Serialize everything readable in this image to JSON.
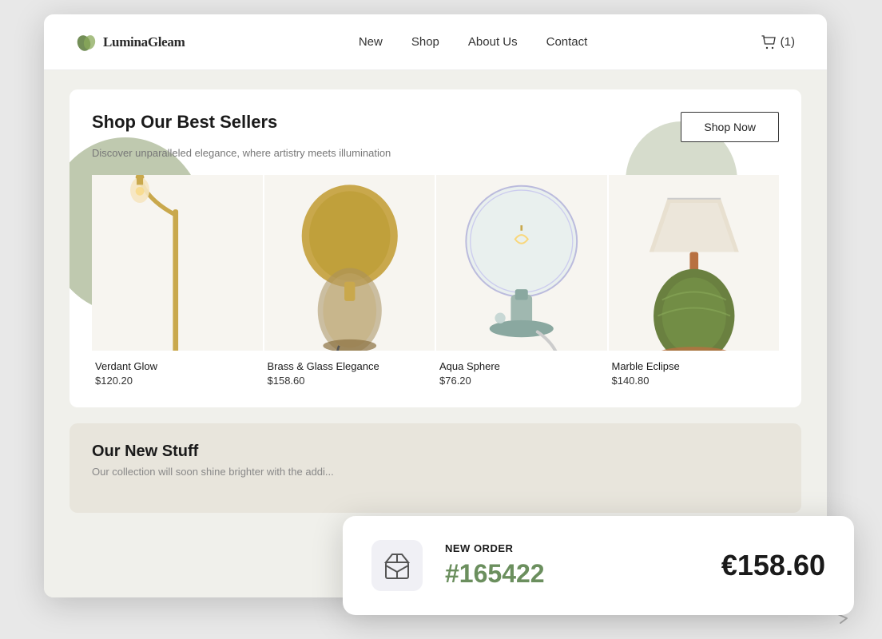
{
  "browser": {
    "background": "#e8e8e8"
  },
  "navbar": {
    "logo_text": "LuminaGleam",
    "nav_items": [
      {
        "label": "New",
        "href": "#"
      },
      {
        "label": "Shop",
        "href": "#"
      },
      {
        "label": "About Us",
        "href": "#"
      },
      {
        "label": "Contact",
        "href": "#"
      }
    ],
    "cart_label": "(1)"
  },
  "best_sellers": {
    "title": "Shop Our Best Sellers",
    "subtitle": "Discover unparalleled elegance, where artistry meets illumination",
    "shop_now_btn": "Shop Now",
    "products": [
      {
        "name": "Verdant Glow",
        "price": "$120.20",
        "lamp_type": "arc"
      },
      {
        "name": "Brass & Glass Elegance",
        "price": "$158.60",
        "lamp_type": "dome"
      },
      {
        "name": "Aqua Sphere",
        "price": "$76.20",
        "lamp_type": "globe"
      },
      {
        "name": "Marble Eclipse",
        "price": "$140.80",
        "lamp_type": "table"
      }
    ]
  },
  "new_stuff": {
    "title": "Our New Stuff",
    "subtitle": "Our collection will soon shine brighter with the addi..."
  },
  "notification": {
    "label": "NEW ORDER",
    "order_number": "#165422",
    "amount": "€158.60"
  }
}
